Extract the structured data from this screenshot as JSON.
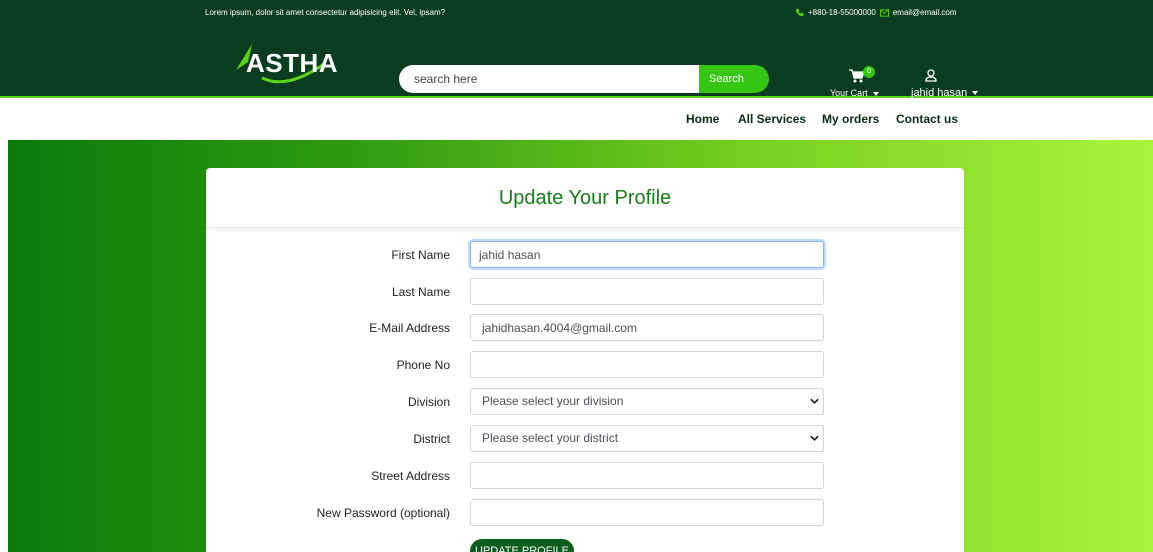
{
  "topbar": {
    "tagline": "Lorem ipsum, dolor sit amet consectetur adipisicing elit. Vel, ipsam?",
    "phone": "+880-18-55000000",
    "email": "email@email.com"
  },
  "header": {
    "logo_text": "ASTHA",
    "search": {
      "placeholder": "search here",
      "button": "Search"
    },
    "cart": {
      "count": "0",
      "label": "Your Cart"
    },
    "user": {
      "name": "jahid hasan"
    }
  },
  "nav": {
    "items": [
      {
        "label": "Home"
      },
      {
        "label": "All Services"
      },
      {
        "label": "My orders"
      },
      {
        "label": "Contact us"
      }
    ]
  },
  "form": {
    "title": "Update Your Profile",
    "fields": [
      {
        "label": "First Name",
        "value": "jahid hasan",
        "placeholder": ""
      },
      {
        "label": "Last Name",
        "value": "",
        "placeholder": ""
      },
      {
        "label": "E-Mail Address",
        "value": "jahidhasan.4004@gmail.com",
        "placeholder": ""
      },
      {
        "label": "Phone No",
        "value": "",
        "placeholder": ""
      },
      {
        "label": "Division",
        "value": "Please select your division"
      },
      {
        "label": "District",
        "value": "Please select your district"
      },
      {
        "label": "Street Address",
        "value": "",
        "placeholder": ""
      },
      {
        "label": "New Password (optional)",
        "value": "",
        "placeholder": ""
      }
    ],
    "submit": "UPDATE PROFILE"
  },
  "colors": {
    "header_bg": "#0a3d1f",
    "accent": "#36c515",
    "title_green": "#1b7a1b",
    "button_bg": "#0a5d1c"
  },
  "icons": [
    "phone-icon",
    "mail-icon",
    "cart-icon",
    "user-icon",
    "chevron-down-icon"
  ]
}
